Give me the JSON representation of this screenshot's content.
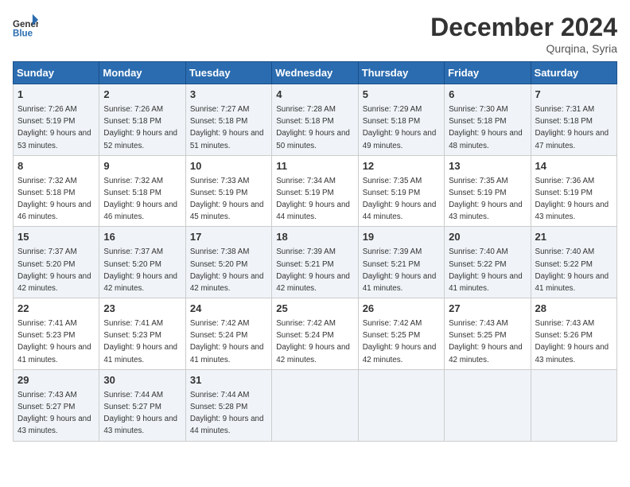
{
  "header": {
    "logo_line1": "General",
    "logo_line2": "Blue",
    "month": "December 2024",
    "location": "Qurqina, Syria"
  },
  "weekdays": [
    "Sunday",
    "Monday",
    "Tuesday",
    "Wednesday",
    "Thursday",
    "Friday",
    "Saturday"
  ],
  "weeks": [
    [
      {
        "day": 1,
        "sunrise": "7:26 AM",
        "sunset": "5:19 PM",
        "daylight": "9 hours and 53 minutes."
      },
      {
        "day": 2,
        "sunrise": "7:26 AM",
        "sunset": "5:18 PM",
        "daylight": "9 hours and 52 minutes."
      },
      {
        "day": 3,
        "sunrise": "7:27 AM",
        "sunset": "5:18 PM",
        "daylight": "9 hours and 51 minutes."
      },
      {
        "day": 4,
        "sunrise": "7:28 AM",
        "sunset": "5:18 PM",
        "daylight": "9 hours and 50 minutes."
      },
      {
        "day": 5,
        "sunrise": "7:29 AM",
        "sunset": "5:18 PM",
        "daylight": "9 hours and 49 minutes."
      },
      {
        "day": 6,
        "sunrise": "7:30 AM",
        "sunset": "5:18 PM",
        "daylight": "9 hours and 48 minutes."
      },
      {
        "day": 7,
        "sunrise": "7:31 AM",
        "sunset": "5:18 PM",
        "daylight": "9 hours and 47 minutes."
      }
    ],
    [
      {
        "day": 8,
        "sunrise": "7:32 AM",
        "sunset": "5:18 PM",
        "daylight": "9 hours and 46 minutes."
      },
      {
        "day": 9,
        "sunrise": "7:32 AM",
        "sunset": "5:18 PM",
        "daylight": "9 hours and 46 minutes."
      },
      {
        "day": 10,
        "sunrise": "7:33 AM",
        "sunset": "5:19 PM",
        "daylight": "9 hours and 45 minutes."
      },
      {
        "day": 11,
        "sunrise": "7:34 AM",
        "sunset": "5:19 PM",
        "daylight": "9 hours and 44 minutes."
      },
      {
        "day": 12,
        "sunrise": "7:35 AM",
        "sunset": "5:19 PM",
        "daylight": "9 hours and 44 minutes."
      },
      {
        "day": 13,
        "sunrise": "7:35 AM",
        "sunset": "5:19 PM",
        "daylight": "9 hours and 43 minutes."
      },
      {
        "day": 14,
        "sunrise": "7:36 AM",
        "sunset": "5:19 PM",
        "daylight": "9 hours and 43 minutes."
      }
    ],
    [
      {
        "day": 15,
        "sunrise": "7:37 AM",
        "sunset": "5:20 PM",
        "daylight": "9 hours and 42 minutes."
      },
      {
        "day": 16,
        "sunrise": "7:37 AM",
        "sunset": "5:20 PM",
        "daylight": "9 hours and 42 minutes."
      },
      {
        "day": 17,
        "sunrise": "7:38 AM",
        "sunset": "5:20 PM",
        "daylight": "9 hours and 42 minutes."
      },
      {
        "day": 18,
        "sunrise": "7:39 AM",
        "sunset": "5:21 PM",
        "daylight": "9 hours and 42 minutes."
      },
      {
        "day": 19,
        "sunrise": "7:39 AM",
        "sunset": "5:21 PM",
        "daylight": "9 hours and 41 minutes."
      },
      {
        "day": 20,
        "sunrise": "7:40 AM",
        "sunset": "5:22 PM",
        "daylight": "9 hours and 41 minutes."
      },
      {
        "day": 21,
        "sunrise": "7:40 AM",
        "sunset": "5:22 PM",
        "daylight": "9 hours and 41 minutes."
      }
    ],
    [
      {
        "day": 22,
        "sunrise": "7:41 AM",
        "sunset": "5:23 PM",
        "daylight": "9 hours and 41 minutes."
      },
      {
        "day": 23,
        "sunrise": "7:41 AM",
        "sunset": "5:23 PM",
        "daylight": "9 hours and 41 minutes."
      },
      {
        "day": 24,
        "sunrise": "7:42 AM",
        "sunset": "5:24 PM",
        "daylight": "9 hours and 41 minutes."
      },
      {
        "day": 25,
        "sunrise": "7:42 AM",
        "sunset": "5:24 PM",
        "daylight": "9 hours and 42 minutes."
      },
      {
        "day": 26,
        "sunrise": "7:42 AM",
        "sunset": "5:25 PM",
        "daylight": "9 hours and 42 minutes."
      },
      {
        "day": 27,
        "sunrise": "7:43 AM",
        "sunset": "5:25 PM",
        "daylight": "9 hours and 42 minutes."
      },
      {
        "day": 28,
        "sunrise": "7:43 AM",
        "sunset": "5:26 PM",
        "daylight": "9 hours and 43 minutes."
      }
    ],
    [
      {
        "day": 29,
        "sunrise": "7:43 AM",
        "sunset": "5:27 PM",
        "daylight": "9 hours and 43 minutes."
      },
      {
        "day": 30,
        "sunrise": "7:44 AM",
        "sunset": "5:27 PM",
        "daylight": "9 hours and 43 minutes."
      },
      {
        "day": 31,
        "sunrise": "7:44 AM",
        "sunset": "5:28 PM",
        "daylight": "9 hours and 44 minutes."
      },
      null,
      null,
      null,
      null
    ]
  ]
}
